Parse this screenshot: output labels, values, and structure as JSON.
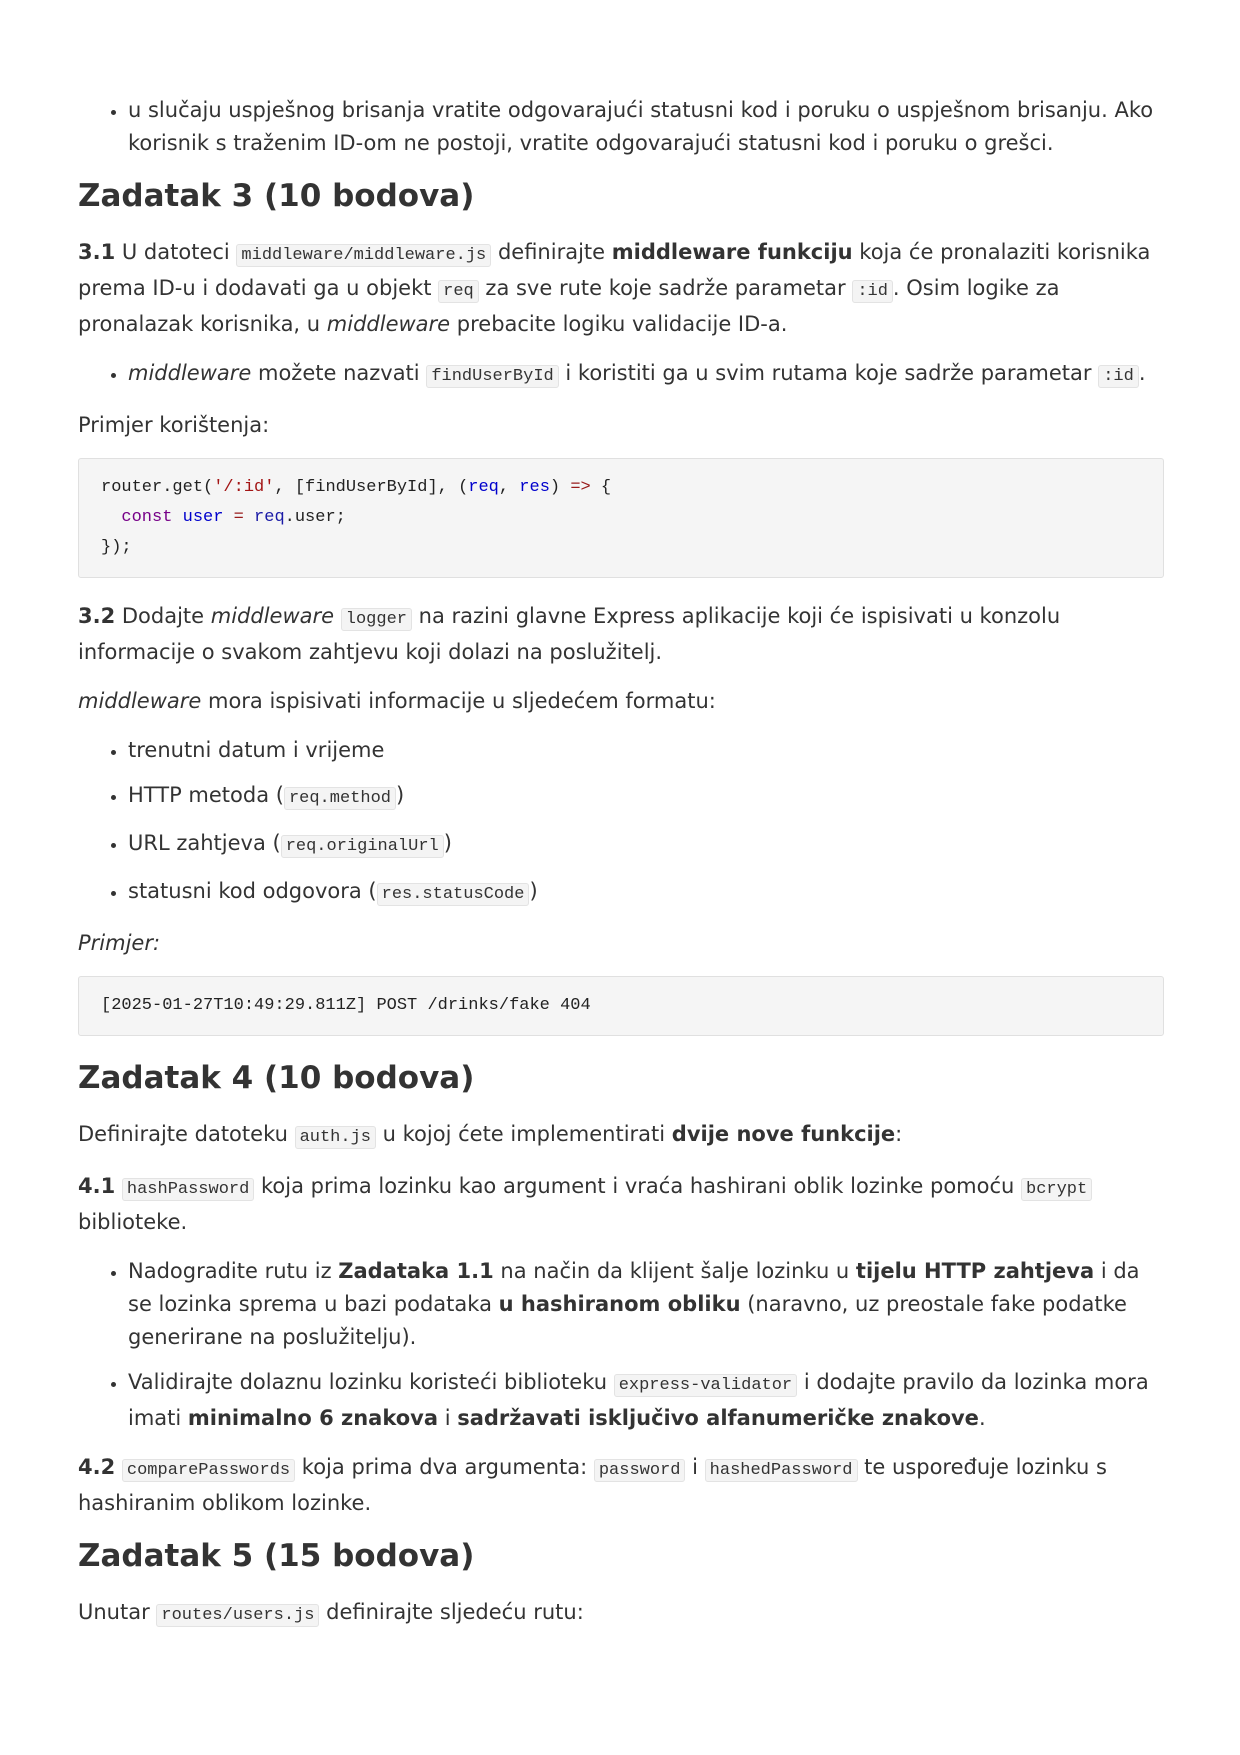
{
  "top_bullet": {
    "text": "u slučaju uspješnog brisanja vratite odgovarajući statusni kod i poruku o uspješnom brisanju. Ako korisnik s traženim ID-om ne postoji, vratite odgovarajući statusni kod i poruku o grešci."
  },
  "z3": {
    "heading": "Zadatak 3 (10 bodova)",
    "p31": {
      "num": "3.1",
      "t1": " U datoteci ",
      "c1": "middleware/middleware.js",
      "t2": " definirajte ",
      "b1": "middleware funkciju",
      "t3": " koja će pronalaziti korisnika prema ID-u i dodavati ga u objekt ",
      "c2": "req",
      "t4": " za sve rute koje sadrže parametar ",
      "c3": ":id",
      "t5": ". Osim logike za pronalazak korisnika, u ",
      "i1": "middleware",
      "t6": " prebacite logiku validacije ID-a."
    },
    "bullet1": {
      "i1": "middleware",
      "t1": " možete nazvati ",
      "c1": "findUserById",
      "t2": " i koristiti ga u svim rutama koje sadrže parametar ",
      "c2": ":id",
      "t3": "."
    },
    "example_label": "Primjer korištenja:",
    "code1": {
      "l1a": "router.get(",
      "l1b": "'/:id'",
      "l1c": ", [findUserById], (",
      "l1d": "req",
      "l1e": ", ",
      "l1f": "res",
      "l1g": ") ",
      "l1h": "=>",
      "l1i": " {",
      "l2a": "  ",
      "l2b": "const",
      "l2c": " ",
      "l2d": "user",
      "l2e": " ",
      "l2f": "=",
      "l2g": " ",
      "l2h": "req",
      "l2i": ".user;",
      "l3": "});"
    },
    "p32": {
      "num": "3.2",
      "t1": " Dodajte ",
      "i1": "middleware",
      "t2": " ",
      "c1": "logger",
      "t3": " na razini glavne Express aplikacije koji će ispisivati u konzolu informacije o svakom zahtjevu koji dolazi na poslužitelj."
    },
    "format_p": {
      "i1": "middleware",
      "t1": " mora ispisivati informacije u sljedećem formatu:"
    },
    "list": [
      {
        "t1": "trenutni datum i vrijeme"
      },
      {
        "t1": "HTTP metoda (",
        "c1": "req.method",
        "t2": ")"
      },
      {
        "t1": "URL zahtjeva (",
        "c1": "req.originalUrl",
        "t2": ")"
      },
      {
        "t1": "statusni kod odgovora (",
        "c1": "res.statusCode",
        "t2": ")"
      }
    ],
    "primjer": "Primjer:",
    "code2": "[2025-01-27T10:49:29.811Z] POST /drinks/fake 404"
  },
  "z4": {
    "heading": "Zadatak 4 (10 bodova)",
    "intro": {
      "t1": "Definirajte datoteku ",
      "c1": "auth.js",
      "t2": " u kojoj ćete implementirati ",
      "b1": "dvije nove funkcije",
      "t3": ":"
    },
    "p41": {
      "num": "4.1",
      "t0": " ",
      "c1": "hashPassword",
      "t1": " koja prima lozinku kao argument i vraća hashirani oblik lozinke pomoću ",
      "c2": "bcrypt",
      "t2": " biblioteke."
    },
    "bullet1": {
      "t1": "Nadogradite rutu iz ",
      "b1": "Zadataka 1.1",
      "t2": " na način da klijent šalje lozinku u ",
      "b2": "tijelu HTTP zahtjeva",
      "t3": " i da se lozinka sprema u bazi podataka ",
      "b3": "u hashiranom obliku",
      "t4": " (naravno, uz preostale fake podatke generirane na poslužitelju)."
    },
    "bullet2": {
      "t1": "Validirajte dolaznu lozinku koristeći biblioteku ",
      "c1": "express-validator",
      "t2": " i dodajte pravilo da lozinka mora imati ",
      "b1": "minimalno 6 znakova",
      "t3": " i ",
      "b2": "sadržavati isključivo alfanumeričke znakove",
      "t4": "."
    },
    "p42": {
      "num": "4.2",
      "t0": " ",
      "c1": "comparePasswords",
      "t1": " koja prima dva argumenta: ",
      "c2": "password",
      "t2": " i ",
      "c3": "hashedPassword",
      "t3": " te uspoređuje lozinku s hashiranim oblikom lozinke."
    }
  },
  "z5": {
    "heading": "Zadatak 5 (15 bodova)",
    "intro": {
      "t1": "Unutar ",
      "c1": "routes/users.js",
      "t2": " definirajte sljedeću rutu:"
    }
  }
}
